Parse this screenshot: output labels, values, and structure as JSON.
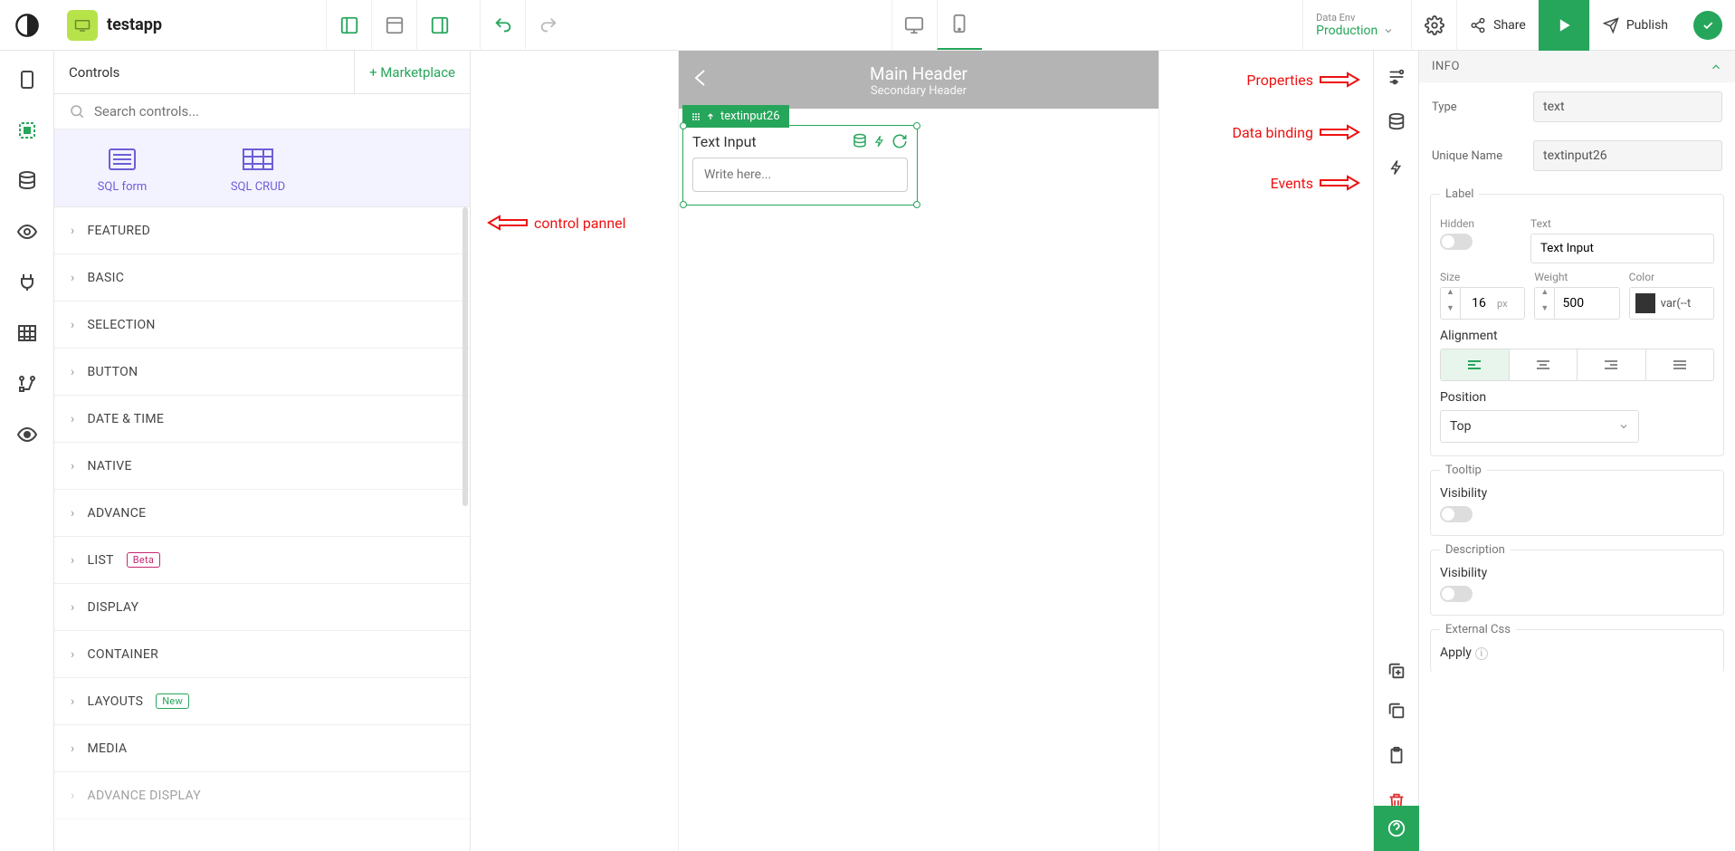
{
  "app": {
    "name": "testapp"
  },
  "topbar": {
    "dataenv_label": "Data Env",
    "dataenv_value": "Production",
    "share": "Share",
    "publish": "Publish"
  },
  "controls_panel": {
    "title": "Controls",
    "marketplace": "+ Marketplace",
    "search_placeholder": "Search controls...",
    "quick": [
      {
        "label": "SQL form"
      },
      {
        "label": "SQL CRUD"
      }
    ],
    "categories": [
      {
        "label": "FEATURED"
      },
      {
        "label": "BASIC"
      },
      {
        "label": "SELECTION"
      },
      {
        "label": "BUTTON"
      },
      {
        "label": "DATE & TIME"
      },
      {
        "label": "NATIVE"
      },
      {
        "label": "ADVANCE"
      },
      {
        "label": "LIST",
        "badge": "Beta"
      },
      {
        "label": "DISPLAY"
      },
      {
        "label": "CONTAINER"
      },
      {
        "label": "LAYOUTS",
        "badge": "New"
      },
      {
        "label": "MEDIA"
      },
      {
        "label": "ADVANCE DISPLAY"
      }
    ]
  },
  "canvas": {
    "main_header": "Main Header",
    "secondary_header": "Secondary Header",
    "widget_tag": "textinput26",
    "widget_label": "Text Input",
    "widget_placeholder": "Write here..."
  },
  "annotations": {
    "control_panel": "control pannel",
    "properties": "Properties",
    "databinding": "Data binding",
    "events": "Events"
  },
  "props": {
    "section_info": "INFO",
    "type_label": "Type",
    "type_value": "text",
    "uname_label": "Unique Name",
    "uname_value": "textinput26",
    "label_group": "Label",
    "hidden_label": "Hidden",
    "text_label": "Text",
    "text_value": "Text Input",
    "size_label": "Size",
    "size_value": "16",
    "size_unit": "px",
    "weight_label": "Weight",
    "weight_value": "500",
    "color_label": "Color",
    "color_value": "var(--t",
    "alignment_label": "Alignment",
    "position_label": "Position",
    "position_value": "Top",
    "tooltip_group": "Tooltip",
    "visibility_label": "Visibility",
    "description_group": "Description",
    "externalcss_group": "External Css",
    "apply_label": "Apply"
  }
}
